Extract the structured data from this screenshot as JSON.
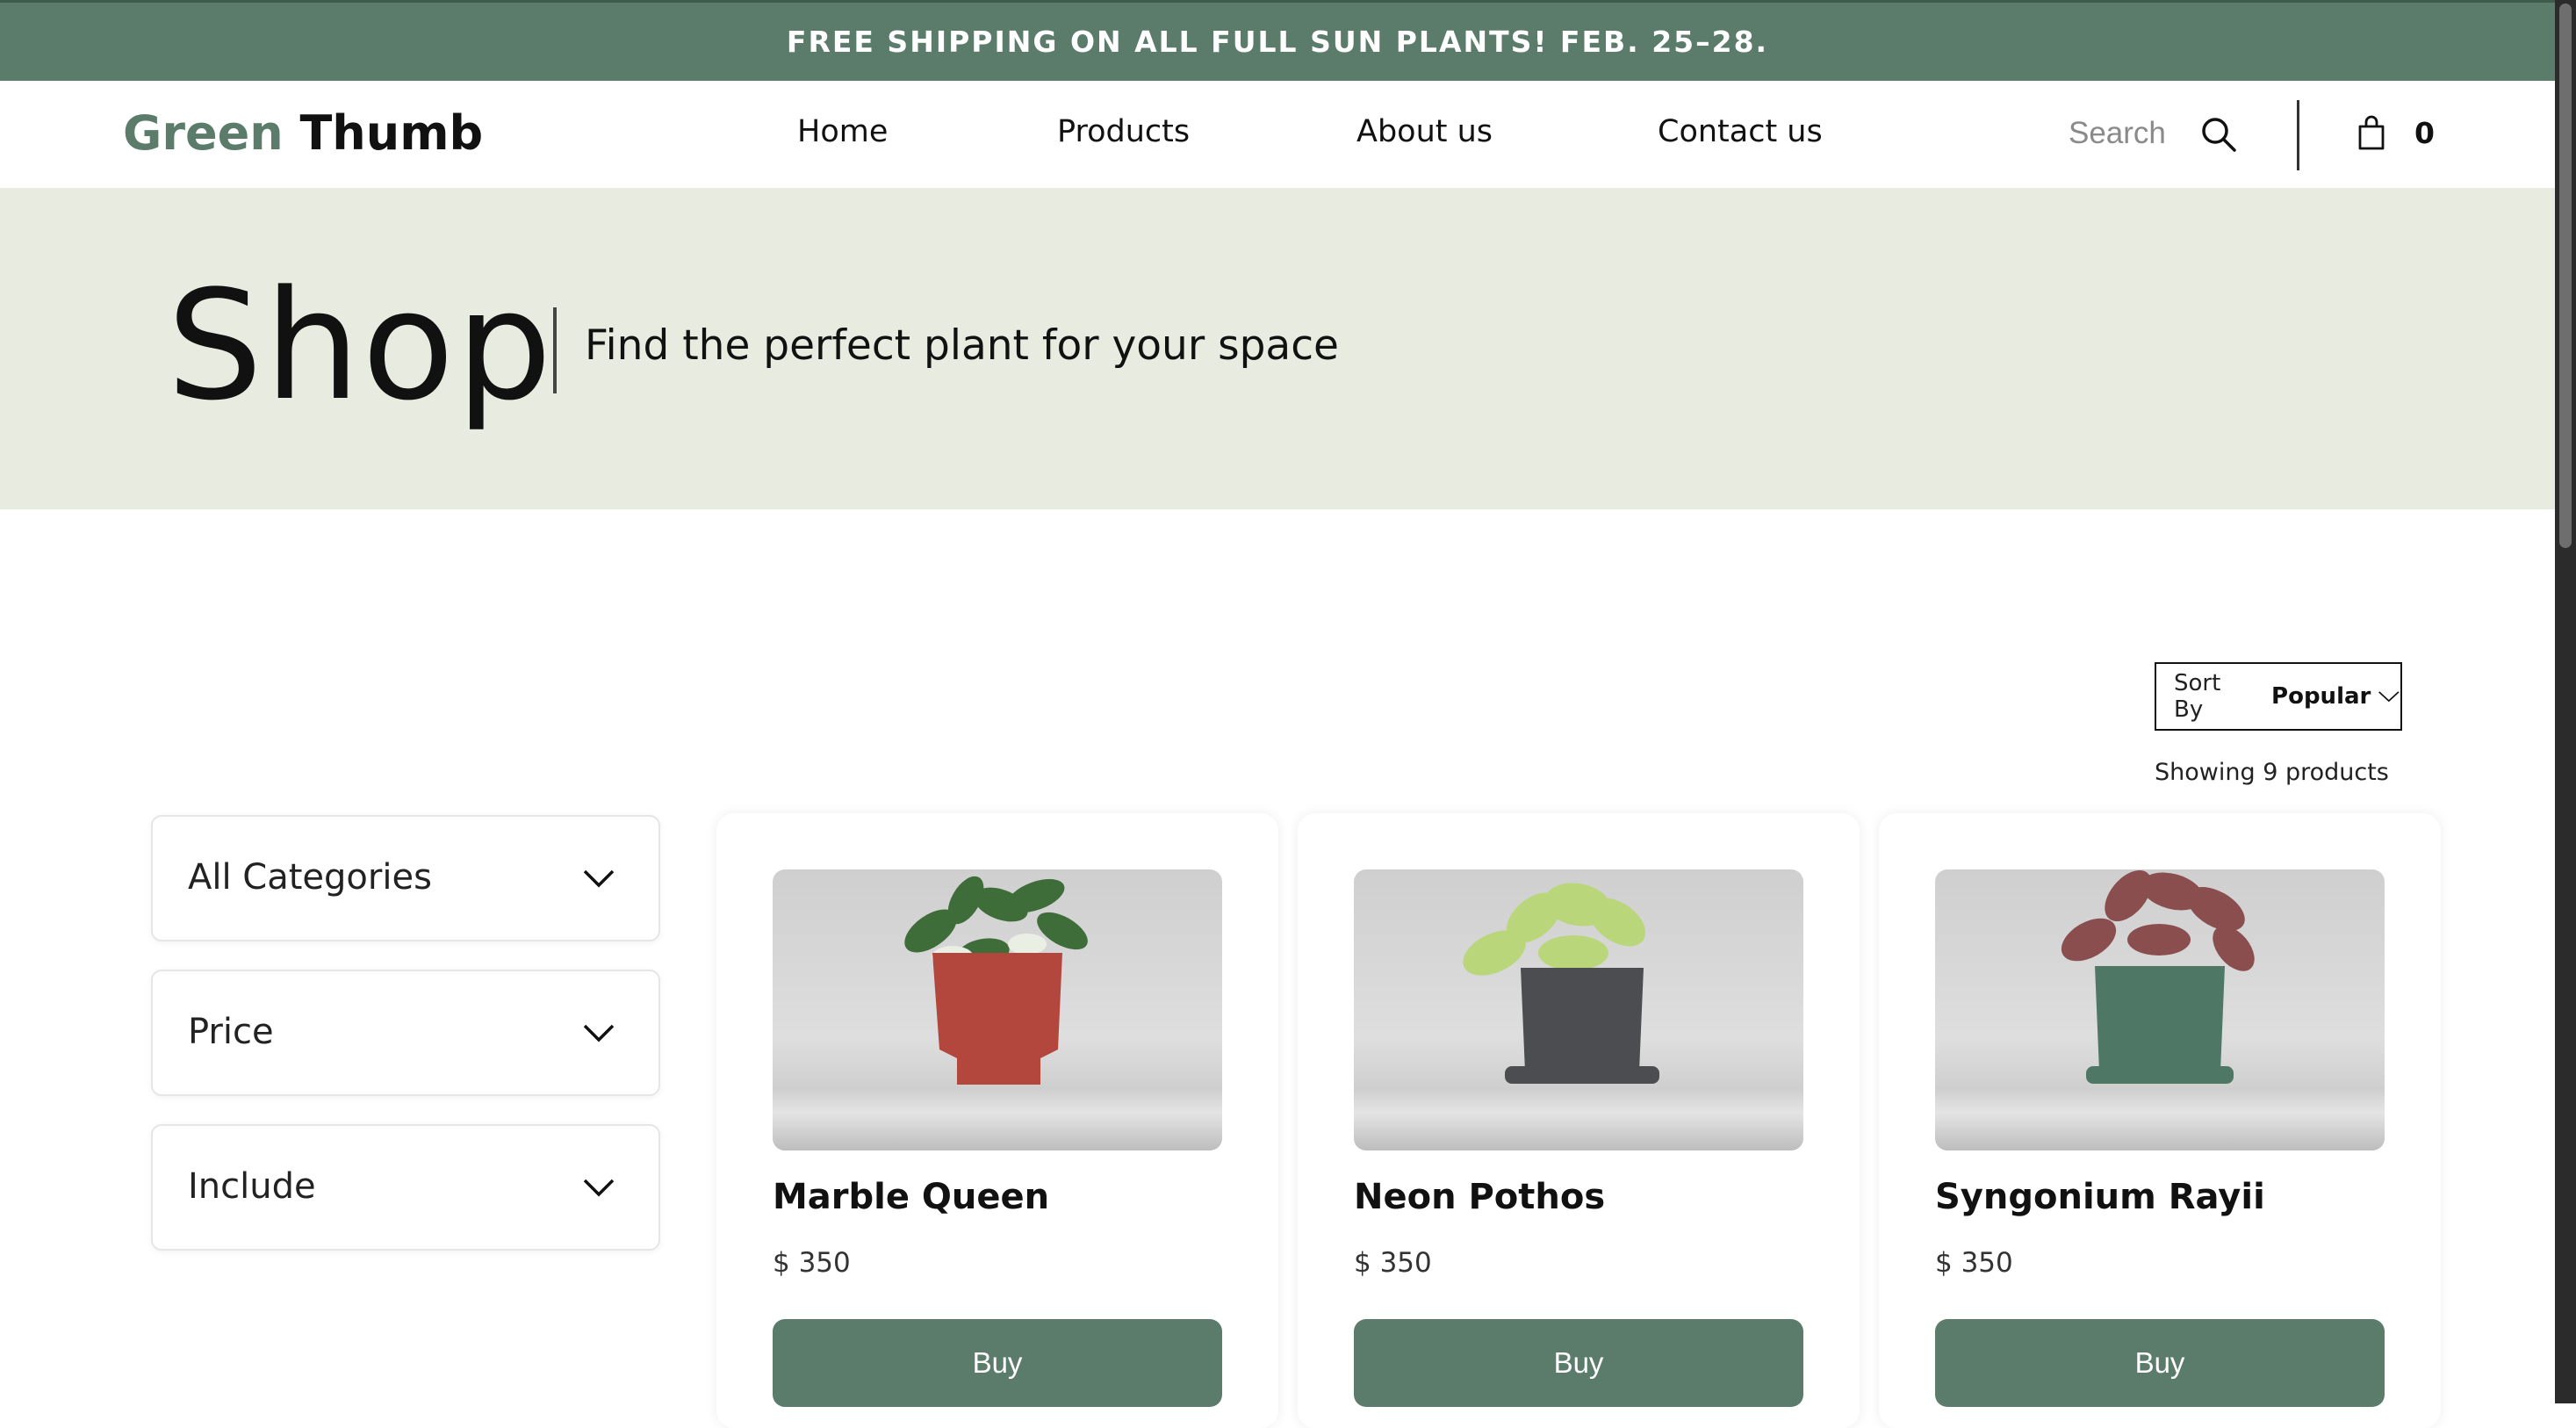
{
  "announcement": {
    "text": "FREE SHIPPING ON ALL FULL SUN PLANTS! FEB. 25–28."
  },
  "header": {
    "logo": {
      "part1": "Green",
      "part2": "Thumb"
    },
    "nav": [
      {
        "label": "Home"
      },
      {
        "label": "Products"
      },
      {
        "label": "About us"
      },
      {
        "label": "Contact us"
      }
    ],
    "search_label": "Search",
    "cart_count": "0"
  },
  "hero": {
    "title": "Shop",
    "subtitle": "Find the perfect plant for your space"
  },
  "sort": {
    "label": "Sort By",
    "value": "Popular"
  },
  "showing_text": "Showing 9 products",
  "filters": [
    {
      "label": "All Categories"
    },
    {
      "label": "Price"
    },
    {
      "label": "Include"
    }
  ],
  "products": [
    {
      "name": "Marble Queen",
      "price": "$ 350",
      "buy_label": "Buy",
      "pot_color": "#b4473d",
      "leaf_color": "#3f6d3a"
    },
    {
      "name": "Neon Pothos",
      "price": "$ 350",
      "buy_label": "Buy",
      "pot_color": "#4b4d50",
      "leaf_color": "#b9d77a"
    },
    {
      "name": "Syngonium Rayii",
      "price": "$ 350",
      "buy_label": "Buy",
      "pot_color": "#4f7766",
      "leaf_color": "#8a4e4e"
    }
  ],
  "colors": {
    "brand_green": "#5c7c6b",
    "hero_bg": "#e7ebe0"
  }
}
